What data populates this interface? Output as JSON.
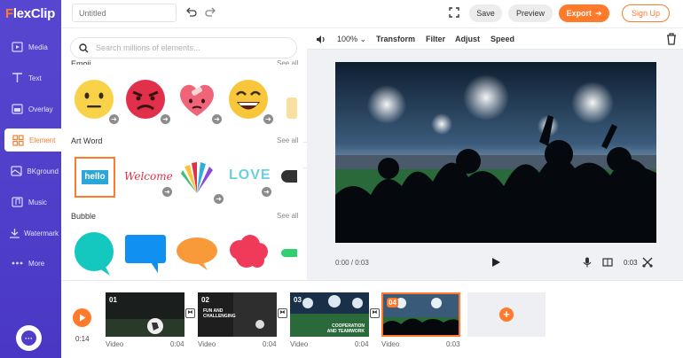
{
  "app": {
    "logo_f": "F",
    "logo_rest": "lexClip"
  },
  "sidebar": {
    "items": [
      {
        "label": "Media",
        "icon": "media-icon"
      },
      {
        "label": "Text",
        "icon": "text-icon"
      },
      {
        "label": "Overlay",
        "icon": "overlay-icon"
      },
      {
        "label": "Element",
        "icon": "element-icon"
      },
      {
        "label": "BKground",
        "icon": "background-icon"
      },
      {
        "label": "Music",
        "icon": "music-icon"
      },
      {
        "label": "Watermark",
        "icon": "watermark-icon"
      },
      {
        "label": "More",
        "icon": "more-icon"
      }
    ],
    "active": "Element"
  },
  "topbar": {
    "title_placeholder": "Untitled",
    "save": "Save",
    "preview": "Preview",
    "export": "Export",
    "signup": "Sign Up"
  },
  "panel": {
    "search_placeholder": "Search millions of elements...",
    "sections": [
      {
        "title": "Emoji",
        "see_all": "See all"
      },
      {
        "title": "Art Word",
        "see_all": "See all"
      },
      {
        "title": "Bubble",
        "see_all": "See all"
      }
    ],
    "art_words": [
      "hello",
      "Welcome",
      "LOVE"
    ]
  },
  "toolbar": {
    "volume": "100%",
    "transform": "Transform",
    "filter": "Filter",
    "adjust": "Adjust",
    "speed": "Speed"
  },
  "player": {
    "timecode": "0:00 / 0:03",
    "duration": "0:03"
  },
  "timeline": {
    "current_time": "0:14",
    "clips": [
      {
        "num": "01",
        "type": "Video",
        "duration": "0:04",
        "caption": ""
      },
      {
        "num": "02",
        "type": "Video",
        "duration": "0:04",
        "caption_1": "FUN AND",
        "caption_2": "CHALLENGING"
      },
      {
        "num": "03",
        "type": "Video",
        "duration": "0:04",
        "caption_1": "COOPERATION",
        "caption_2": "AND TEAMWORK"
      },
      {
        "num": "04",
        "type": "Video",
        "duration": "0:03"
      }
    ]
  },
  "colors": {
    "brand": "#4e3ec8",
    "accent": "#ff7a2a"
  }
}
